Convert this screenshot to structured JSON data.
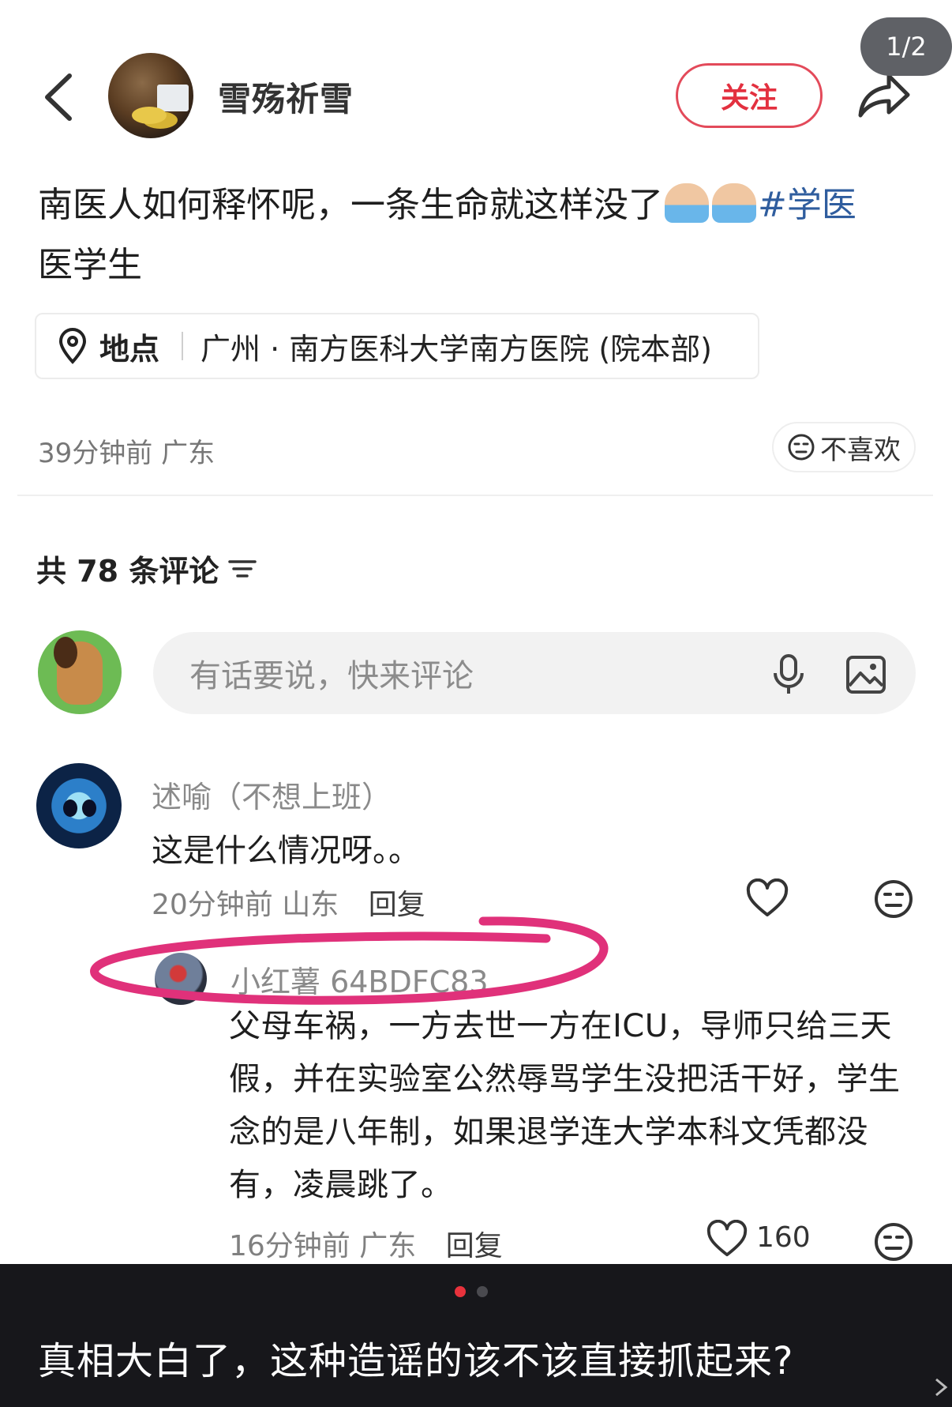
{
  "header": {
    "username": "雪殇祈雪",
    "follow_label": "关注",
    "page_indicator": "1/2"
  },
  "post": {
    "text_main": "南医人如何释怀呢，一条生命就这样没了",
    "hashtag": "#学医",
    "text_tail": "医学生",
    "location_label": "地点",
    "location_value": "广州 · 南方医科大学南方医院 (院本部)",
    "time_region": "39分钟前 广东",
    "dislike_label": "不喜欢"
  },
  "comments": {
    "count_label": "共 78 条评论",
    "input_placeholder": "有话要说，快来评论",
    "items": [
      {
        "name": "述喻（不想上班）",
        "text": "这是什么情况呀。。",
        "time_region": "20分钟前 山东",
        "reply_label": "回复"
      }
    ],
    "reply": {
      "name": "小红薯 64BDFC83",
      "text": "父母车祸，一方去世一方在ICU，导师只给三天假，并在实验室公然辱骂学生没把活干好，学生念的是八年制，如果退学连大学本科文凭都没有，凌晨跳了。",
      "time_region": "16分钟前 广东",
      "reply_label": "回复",
      "like_count": "160"
    }
  },
  "overlay": {
    "caption": "真相大白了，这种造谣的该不该直接抓起来?"
  },
  "colors": {
    "accent_red": "#e3303f",
    "annotation_pink": "#e0317a",
    "hashtag_blue": "#2f5d9e",
    "overlay_bg": "#17171b"
  },
  "icons": [
    "back-icon",
    "share-icon",
    "location-pin-icon",
    "dislike-face-icon",
    "filter-icon",
    "microphone-icon",
    "image-icon",
    "heart-icon"
  ]
}
